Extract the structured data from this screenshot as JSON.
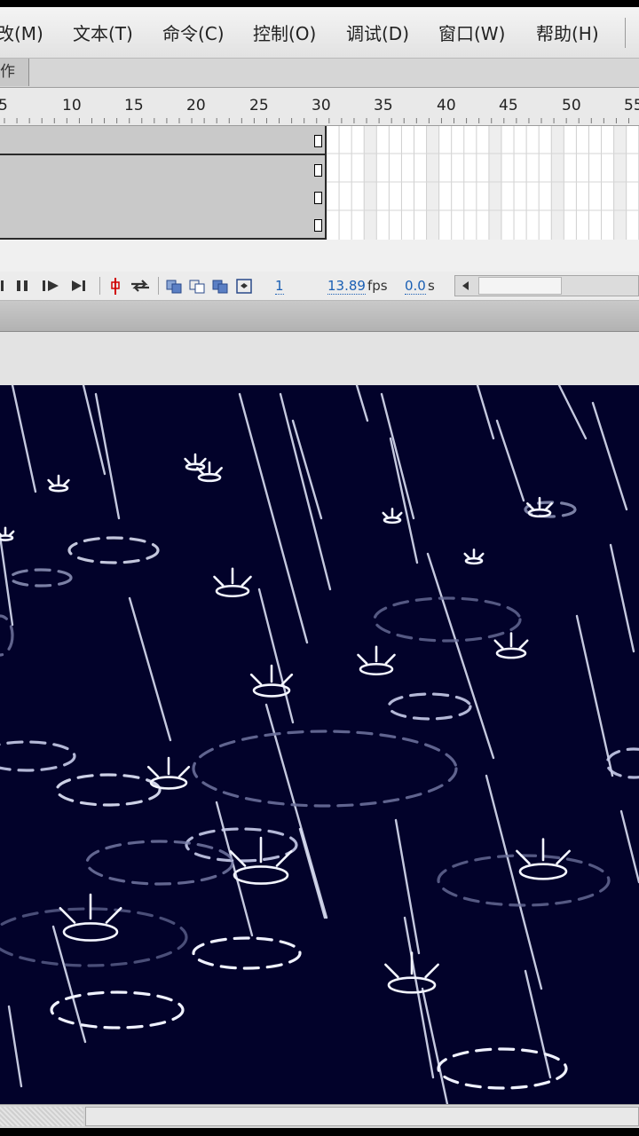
{
  "menu": {
    "items": [
      {
        "label": "改(M)",
        "name": "menu-modify"
      },
      {
        "label": "文本(T)",
        "name": "menu-text"
      },
      {
        "label": "命令(C)",
        "name": "menu-commands"
      },
      {
        "label": "控制(O)",
        "name": "menu-control"
      },
      {
        "label": "调试(D)",
        "name": "menu-debug"
      },
      {
        "label": "窗口(W)",
        "name": "menu-window"
      },
      {
        "label": "帮助(H)",
        "name": "menu-help"
      }
    ]
  },
  "tab": {
    "label": "作"
  },
  "ruler": {
    "ticks": [
      "5",
      "10",
      "15",
      "20",
      "25",
      "30",
      "35",
      "40",
      "45",
      "50",
      "55"
    ]
  },
  "timeline": {
    "current_frame": "1",
    "fps_value": "13.89",
    "fps_unit": "fps",
    "time_value": "0.0",
    "time_unit": "s"
  },
  "icons": {
    "step-back": "step-back-icon",
    "pause": "pause-icon",
    "play": "play-icon",
    "go-end": "go-to-end-icon",
    "center-frame": "center-frame-icon",
    "loop": "loop-icon",
    "onion-skin": "onion-skin-icon",
    "onion-outline": "onion-skin-outline-icon",
    "edit-multiple": "edit-multiple-frames-icon",
    "modify-markers": "modify-onion-markers-icon",
    "scroll-left": "scroll-left-icon"
  },
  "colors": {
    "stage_bg": "#02022a",
    "link_blue": "#1a5fb4",
    "playhead": "#d00000"
  }
}
